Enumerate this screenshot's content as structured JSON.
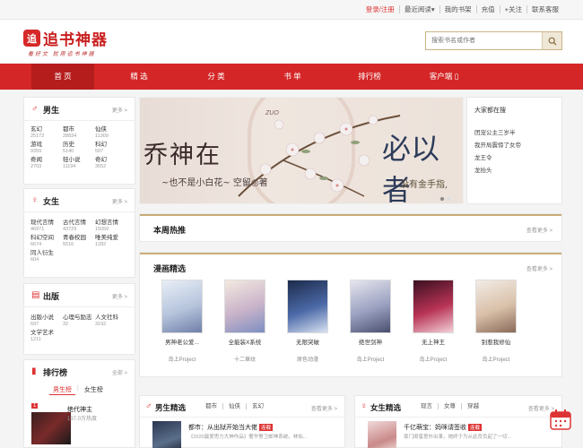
{
  "topbar": {
    "links": [
      "登录/注册",
      "最近阅读▾",
      "我的书架",
      "充值",
      "+关注",
      "联系客服"
    ]
  },
  "header": {
    "logo_char": "追",
    "logo_text": "追书神器",
    "slogan": "看好文 就用追书神器",
    "search_placeholder": "搜索书名或作者"
  },
  "nav": {
    "items": [
      "首 页",
      "精 选",
      "分 类",
      "书 单",
      "排行榜",
      "客户端"
    ],
    "active": 0
  },
  "sidebar": {
    "male": {
      "title": "男生",
      "more": "更多 >",
      "genres": [
        {
          "name": "玄幻",
          "count": "25172"
        },
        {
          "name": "都市",
          "count": "28834"
        },
        {
          "name": "仙侠",
          "count": "11309"
        },
        {
          "name": "游戏",
          "count": "9359"
        },
        {
          "name": "历史",
          "count": "5140"
        },
        {
          "name": "科幻",
          "count": "597"
        },
        {
          "name": "奇闻",
          "count": "2703"
        },
        {
          "name": "轻小说",
          "count": "11194"
        },
        {
          "name": "奇幻",
          "count": "3652"
        }
      ]
    },
    "female": {
      "title": "女生",
      "more": "更多 >",
      "genres": [
        {
          "name": "现代言情",
          "count": "46971"
        },
        {
          "name": "古代言情",
          "count": "43729"
        },
        {
          "name": "幻想言情",
          "count": "15050"
        },
        {
          "name": "科幻空间",
          "count": "6674"
        },
        {
          "name": "青春校园",
          "count": "5516"
        },
        {
          "name": "唯美纯爱",
          "count": "1282"
        },
        {
          "name": "同人衍生",
          "count": "604"
        }
      ]
    },
    "publish": {
      "title": "出版",
      "more": "更多 >",
      "genres": [
        {
          "name": "出版小说",
          "count": "697"
        },
        {
          "name": "心理与励志",
          "count": "32"
        },
        {
          "name": "人文社科",
          "count": "3192"
        },
        {
          "name": "文学艺术",
          "count": "1211"
        }
      ]
    },
    "rank": {
      "title": "排行榜",
      "more": "全部 >",
      "tabs": [
        "男生榜",
        "女生榜"
      ],
      "first_book": {
        "rank": "1",
        "title": "绝代神主",
        "count": "137.0万热度"
      }
    }
  },
  "banner": {
    "left_title": "乔神在",
    "left_sub": "~也不是小白花~ 空留◎著",
    "right_title": "必以者",
    "right_sub": "没有金手指,",
    "zone": "ZUO"
  },
  "hot": {
    "title": "大家都在搜",
    "items": [
      "团宠公主三岁半",
      "我开局震惊了女帝",
      "龙王令",
      "龙抬头"
    ]
  },
  "weekly": {
    "title": "本周热推",
    "more": "查看更多 >"
  },
  "comics": {
    "title": "漫画精选",
    "more": "查看更多 >",
    "items": [
      {
        "title": "男神老公爱...",
        "author": "岛上Project"
      },
      {
        "title": "全能装X系统",
        "author": "十二章纹"
      },
      {
        "title": "无限突破",
        "author": "原色动漫"
      },
      {
        "title": "绝世剑神",
        "author": "岛上Project"
      },
      {
        "title": "无上神王",
        "author": "岛上Project"
      },
      {
        "title": "别惹我修仙",
        "author": "岛上Project"
      }
    ]
  },
  "male_pick": {
    "title": "男生精选",
    "tabs": [
      "都市",
      "仙侠",
      "玄幻"
    ],
    "more": "查看更多 >",
    "item_title": "都市：从出狱开始当大佬",
    "tag": "连载",
    "item_desc": "《2020最爱思力大神作品》奢华警卫邮神系统。林佑..."
  },
  "female_pick": {
    "title": "女生精选",
    "tabs": [
      "现言",
      "女尊",
      "穿越"
    ],
    "more": "查看更多 >",
    "item_title": "千亿萌宝：妈咪请签收",
    "tag": "连载",
    "item_desc": "豪门闺蜜意外出事，她终于为从此背负起了一切..."
  },
  "colors": {
    "brand": "#d42626",
    "accent": "#c9ad78"
  }
}
